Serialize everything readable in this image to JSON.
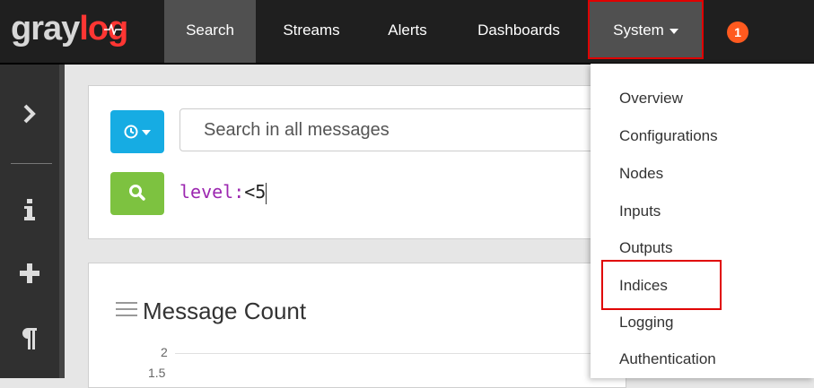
{
  "brand": {
    "name_primary": "gray",
    "name_accent": "log",
    "accent_color": "#ff3633"
  },
  "nav": {
    "items": [
      {
        "label": "Search",
        "active": true
      },
      {
        "label": "Streams"
      },
      {
        "label": "Alerts"
      },
      {
        "label": "Dashboards"
      },
      {
        "label": "System",
        "open": true
      }
    ],
    "notification_count": "1"
  },
  "sidebar": {
    "icons": [
      "chevron-right-icon",
      "info-icon",
      "plus-icon",
      "pilcrow-icon"
    ]
  },
  "search": {
    "placeholder": "Search in all messages",
    "query_key": "level:",
    "query_value": "<5"
  },
  "message_count": {
    "title": "Message Count",
    "y_ticks": [
      "2",
      "1.5"
    ]
  },
  "system_menu": {
    "items": [
      "Overview",
      "Configurations",
      "Nodes",
      "Inputs",
      "Outputs",
      "Indices",
      "Logging",
      "Authentication"
    ],
    "highlighted": "Indices"
  },
  "colors": {
    "navbar_bg": "#1f1f1f",
    "active_nav_bg": "#505050",
    "time_button": "#16ace3",
    "search_button": "#7dc240",
    "badge": "#ff5a1f",
    "highlight_border": "#e00000"
  }
}
